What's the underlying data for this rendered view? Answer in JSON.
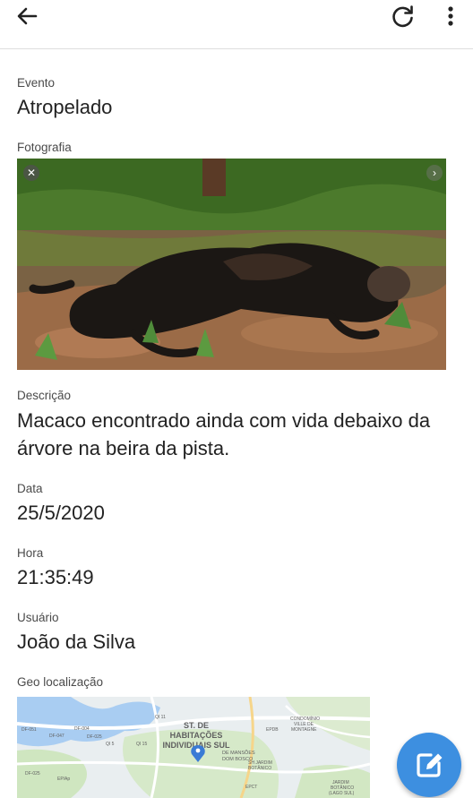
{
  "header": {
    "back_icon": "arrow-left-icon",
    "refresh_icon": "refresh-icon",
    "menu_icon": "more-vertical-icon"
  },
  "fields": {
    "evento_label": "Evento",
    "evento_value": "Atropelado",
    "fotografia_label": "Fotografia",
    "descricao_label": "Descrição",
    "descricao_value": "Macaco encontrado ainda com vida debaixo da árvore na beira da pista.",
    "data_label": "Data",
    "data_value": "25/5/2020",
    "hora_label": "Hora",
    "hora_value": "21:35:49",
    "usuario_label": "Usuário",
    "usuario_value": "João da Silva",
    "geo_label": "Geo localização"
  },
  "photo": {
    "close_glyph": "✕",
    "next_glyph": "›"
  },
  "map": {
    "labels": {
      "st_de": "ST. DE",
      "habitacoes": "HABITAÇÕES",
      "individuais": "INDIVIDUAIS SUL",
      "mansoes1": "DE MANSÕES",
      "mansoes2": "DOM BOSCO",
      "condominio1": "CONDOMÍNIO",
      "condominio2": "VILLE DE",
      "condominio3": "MONTAGNE",
      "jardim1": "SH JARDIM",
      "jardim2": "BOTÂNICO",
      "jardim3": "JARDIM",
      "jardim4": "BOTÂNICO",
      "jardim5": "(LAGO SUL)",
      "qi11": "QI 11",
      "qi15": "QI 15",
      "qi5": "QI 5",
      "df051": "DF-051",
      "df047": "DF-047",
      "df004": "DF-004",
      "df025a": "DF-025",
      "df025b": "DF-025",
      "epap": "EP/Ap",
      "epdb": "EPDB",
      "epct": "EPCT"
    },
    "accent_pin": "#3a7bd5"
  },
  "fab": {
    "icon": "edit-icon",
    "color": "#3d8fe0"
  }
}
